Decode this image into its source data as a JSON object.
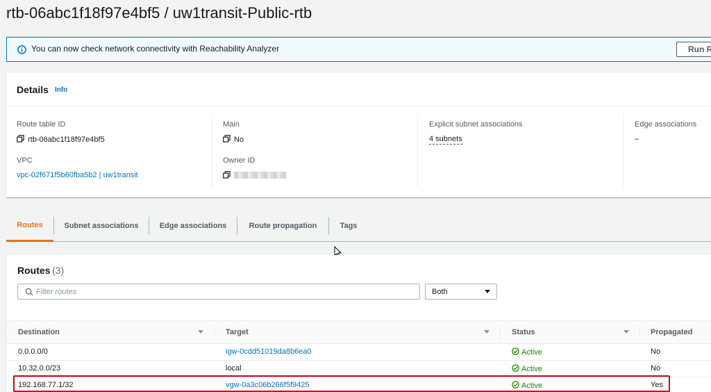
{
  "page": {
    "title": "rtb-06abc1f18f97e4bf5 / uw1transit-Public-rtb"
  },
  "flash": {
    "message": "You can now check network connectivity with Reachability Analyzer",
    "button": "Run Re"
  },
  "details": {
    "heading": "Details",
    "info": "Info",
    "route_table_id": {
      "label": "Route table ID",
      "value": "rtb-06abc1f18f97e4bf5"
    },
    "vpc": {
      "label": "VPC",
      "value": "vpc-02f671f5b60fba5b2 | uw1transit"
    },
    "main": {
      "label": "Main",
      "value": "No"
    },
    "owner_id": {
      "label": "Owner ID"
    },
    "explicit_subnet": {
      "label": "Explicit subnet associations",
      "value": "4 subnets"
    },
    "edge": {
      "label": "Edge associations",
      "value": "–"
    }
  },
  "tabs": [
    "Routes",
    "Subnet associations",
    "Edge associations",
    "Route propagation",
    "Tags"
  ],
  "routes": {
    "title": "Routes",
    "count": "(3)",
    "filter_placeholder": "Filter routes",
    "select_value": "Both",
    "columns": [
      "Destination",
      "Target",
      "Status",
      "Propagated"
    ],
    "rows": [
      {
        "destination": "0.0.0.0/0",
        "target": "igw-0cdd51019da8b6ea0",
        "target_link": true,
        "status": "Active",
        "propagated": "No"
      },
      {
        "destination": "10.32.0.0/23",
        "target": "local",
        "target_link": false,
        "status": "Active",
        "propagated": "No"
      },
      {
        "destination": "192.168.77.1/32",
        "target": "vgw-0a3c06b266f5f9425",
        "target_link": true,
        "status": "Active",
        "propagated": "Yes"
      }
    ]
  },
  "colors": {
    "accent": "#ec7211",
    "link": "#0073bb",
    "success": "#1d8102",
    "highlight": "#d0021b"
  }
}
